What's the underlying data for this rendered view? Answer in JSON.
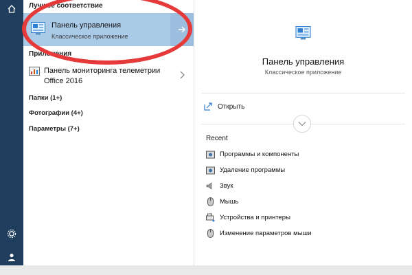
{
  "left": {
    "best_match_header": "Лучшее соответствие",
    "best_match": {
      "title": "Панель управления",
      "subtitle": "Классическое приложение"
    },
    "apps_header": "Приложения",
    "app": {
      "line1": "Панель мониторинга телеметрии",
      "line2": "Office 2016"
    },
    "categories": [
      "Папки (1+)",
      "Фотографии (4+)",
      "Параметры (7+)"
    ]
  },
  "right": {
    "title": "Панель управления",
    "subtitle": "Классическое приложение",
    "open_label": "Открыть",
    "recent_header": "Recent",
    "recent_items": [
      "Программы и компоненты",
      "Удаление программы",
      "Звук",
      "Мышь",
      "Устройства и принтеры",
      "Изменение параметров мыши"
    ]
  },
  "colors": {
    "taskrail": "#1f3d5c",
    "selection": "#aacbe8",
    "annotation": "#e63a3a",
    "accent": "#2f7fd0"
  },
  "icons": [
    "home-icon",
    "control-panel-icon",
    "chevron-right-icon",
    "telemetry-icon",
    "open-icon",
    "chevron-down-icon",
    "programs-icon",
    "uninstall-icon",
    "sound-icon",
    "mouse-icon",
    "devices-icon",
    "settings-gear-icon",
    "user-icon"
  ]
}
